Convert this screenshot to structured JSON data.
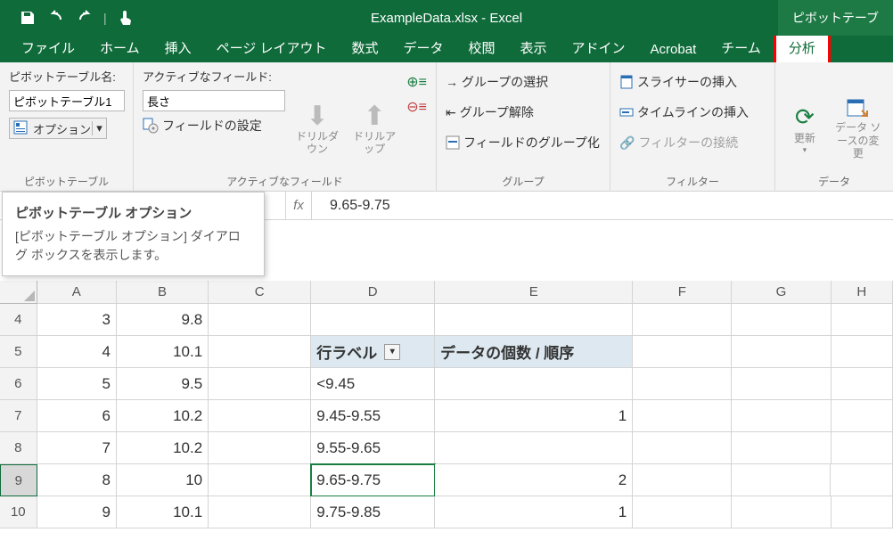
{
  "window": {
    "title": "ExampleData.xlsx - Excel",
    "context_tab": "ピボットテーブ"
  },
  "tabs": [
    "ファイル",
    "ホーム",
    "挿入",
    "ページ レイアウト",
    "数式",
    "データ",
    "校閲",
    "表示",
    "アドイン",
    "Acrobat",
    "チーム",
    "分析"
  ],
  "active_tab_index": 11,
  "ribbon": {
    "g0": {
      "name_label": "ピボットテーブル名:",
      "name_value": "ピボットテーブル1",
      "options_label": "オプション",
      "group_label": "ピボットテーブル"
    },
    "g1": {
      "active_label": "アクティブなフィールド:",
      "active_value": "長さ",
      "field_settings": "フィールドの設定",
      "drill_down": "ドリルダウン",
      "drill_up": "ドリルアップ",
      "group_label": "アクティブなフィールド"
    },
    "g2": {
      "select": "グループの選択",
      "ungroup": "グループ解除",
      "groupfield": "フィールドのグループ化",
      "group_label": "グループ"
    },
    "g3": {
      "slicer": "スライサーの挿入",
      "timeline": "タイムラインの挿入",
      "filterconn": "フィルターの接続",
      "group_label": "フィルター"
    },
    "g4": {
      "refresh": "更新",
      "datasource": "データ ソースの変更",
      "group_label": "データ"
    }
  },
  "tooltip": {
    "title": "ピボットテーブル オプション",
    "body": "[ピボットテーブル オプション] ダイアログ ボックスを表示します。"
  },
  "formula": {
    "value": "9.65-9.75"
  },
  "grid": {
    "cols": [
      "A",
      "B",
      "C",
      "D",
      "E",
      "F",
      "G",
      "H"
    ],
    "rows": [
      {
        "n": "4",
        "A": "3",
        "B": "9.8",
        "D": "",
        "E": ""
      },
      {
        "n": "5",
        "A": "4",
        "B": "10.1",
        "D": "行ラベル",
        "E": "データの個数 / 順序",
        "head": true
      },
      {
        "n": "6",
        "A": "5",
        "B": "9.5",
        "D": "<9.45",
        "E": ""
      },
      {
        "n": "7",
        "A": "6",
        "B": "10.2",
        "D": "9.45-9.55",
        "E": "1"
      },
      {
        "n": "8",
        "A": "7",
        "B": "10.2",
        "D": "9.55-9.65",
        "E": ""
      },
      {
        "n": "9",
        "A": "8",
        "B": "10",
        "D": "9.65-9.75",
        "E": "2",
        "sel": true
      },
      {
        "n": "10",
        "A": "9",
        "B": "10.1",
        "D": "9.75-9.85",
        "E": "1"
      }
    ]
  }
}
